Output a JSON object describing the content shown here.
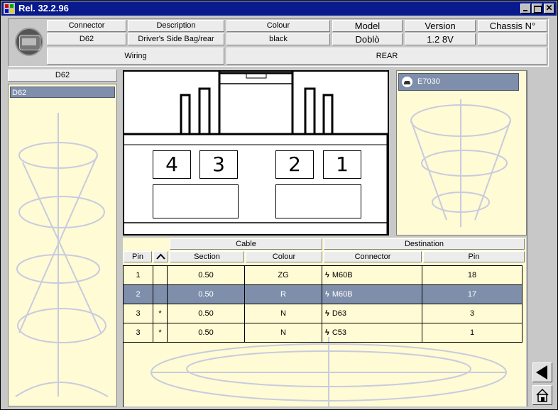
{
  "window": {
    "title": "Rel. 32.2.96"
  },
  "header": {
    "col_labels": {
      "connector": "Connector",
      "description": "Description",
      "colour": "Colour",
      "model": "Model",
      "version": "Version",
      "chassis": "Chassis N°"
    },
    "values": {
      "connector": "D62",
      "description": "Driver's Side Bag/rear",
      "colour": "black",
      "model": "Doblò",
      "version": "1.2 8V",
      "chassis": ""
    },
    "wiring_label": "Wiring",
    "wiring_value": "REAR"
  },
  "left_panel": {
    "header": "D62",
    "items": [
      "D62"
    ]
  },
  "connector_diagram": {
    "pins": [
      "4",
      "3",
      "2",
      "1"
    ]
  },
  "right_panel": {
    "item": "E7030"
  },
  "table": {
    "group_headers": {
      "cable": "Cable",
      "destination": "Destination"
    },
    "columns": {
      "pin": "Pin",
      "section": "Section",
      "colour": "Colour",
      "connector": "Connector",
      "dest_pin": "Pin"
    },
    "rows": [
      {
        "pin": "1",
        "flag": "",
        "section": "0.50",
        "colour": "ZG",
        "connector": "M60B",
        "dest_pin": "18"
      },
      {
        "pin": "2",
        "flag": "",
        "section": "0.50",
        "colour": "R",
        "connector": "M60B",
        "dest_pin": "17"
      },
      {
        "pin": "3",
        "flag": "*",
        "section": "0.50",
        "colour": "N",
        "connector": "D63",
        "dest_pin": "3"
      },
      {
        "pin": "3",
        "flag": "*",
        "section": "0.50",
        "colour": "N",
        "connector": "C53",
        "dest_pin": "1"
      }
    ],
    "selected_row": 1
  },
  "icons": {
    "logo": "fiat-logo",
    "car": "car-icon",
    "bolt": "lightning-icon",
    "sort": "sort-icon",
    "back": "back-arrow-icon",
    "home": "home-icon"
  },
  "colors": {
    "titlebar": "#081a8c",
    "panel": "#fffbd4",
    "selection": "#7f8fab"
  }
}
